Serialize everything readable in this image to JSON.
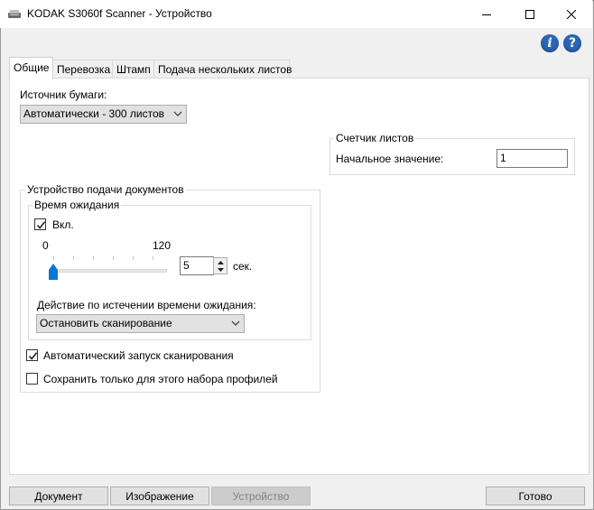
{
  "window": {
    "title": "KODAK S3060f Scanner - Устройство"
  },
  "icons": {
    "info": "i",
    "help": "?"
  },
  "tabs": [
    {
      "label": "Общие",
      "active": true
    },
    {
      "label": "Перевозка",
      "active": false
    },
    {
      "label": "Штамп",
      "active": false
    },
    {
      "label": "Подача нескольких листов",
      "active": false
    }
  ],
  "paper_source": {
    "label": "Источник бумаги:",
    "value": "Автоматически - 300 листов"
  },
  "sheet_counter": {
    "title": "Счетчик листов",
    "start_label": "Начальное значение:",
    "start_value": "1"
  },
  "feeder": {
    "title": "Устройство подачи документов",
    "timeout": {
      "title": "Время ожидания",
      "enabled_label": "Вкл.",
      "enabled": true,
      "min": "0",
      "max": "120",
      "value": "5",
      "unit": "сек."
    },
    "action_label": "Действие по истечении времени ожидания:",
    "action_value": "Остановить сканирование",
    "auto_start_label": "Автоматический запуск сканирования",
    "auto_start": true,
    "save_profile_label": "Сохранить только для этого набора профилей",
    "save_profile": false
  },
  "buttons": {
    "document": "Документ",
    "image": "Изображение",
    "device": "Устройство",
    "done": "Готово"
  }
}
